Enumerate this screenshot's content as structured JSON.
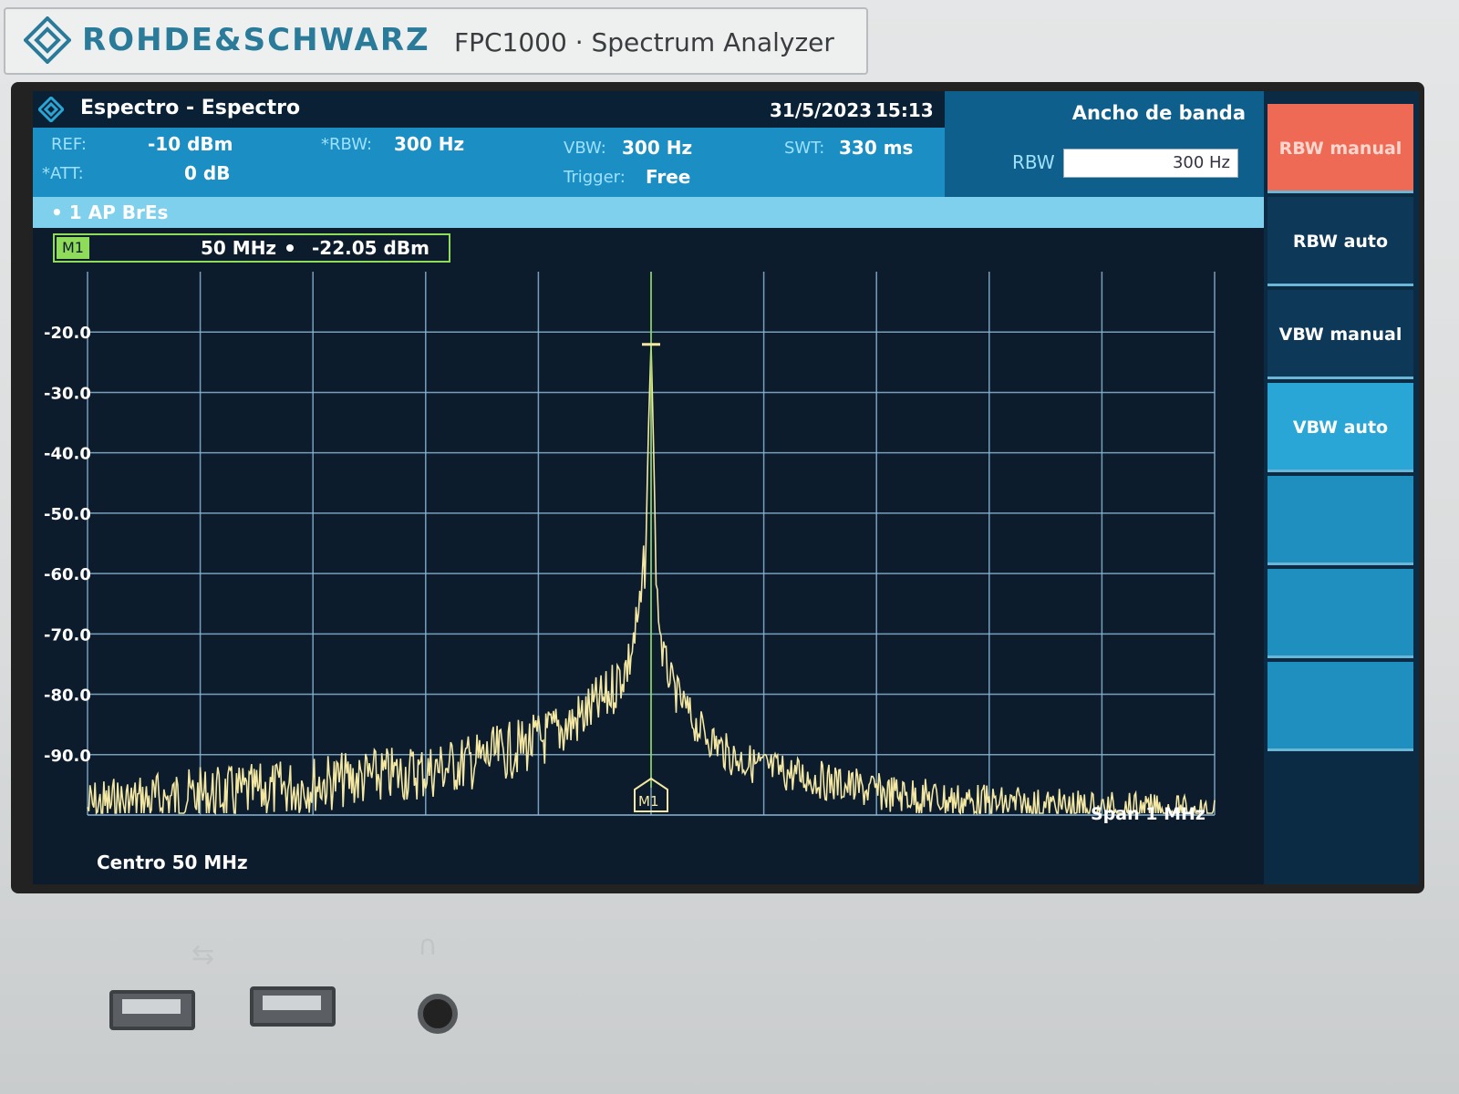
{
  "device": {
    "brand": "ROHDE&SCHWARZ",
    "model": "FPC1000 · Spectrum Analyzer"
  },
  "screen": {
    "title": "Espectro - Espectro",
    "date": "31/5/2023",
    "time": "15:13",
    "params": {
      "ref_label": "REF:",
      "ref_value": "-10 dBm",
      "att_label": "*ATT:",
      "att_value": "0 dB",
      "rbw_label": "*RBW:",
      "rbw_value": "300 Hz",
      "vbw_label": "VBW:",
      "vbw_value": "300 Hz",
      "trigger_label": "Trigger:",
      "trigger_value": "Free",
      "swt_label": "SWT:",
      "swt_value": "330 ms"
    },
    "bandwidth_panel": {
      "title": "Ancho de banda",
      "rbw_label": "RBW",
      "rbw_input_value": "300 Hz"
    },
    "trace_label": "• 1 AP BrEs",
    "marker": {
      "tag": "M1",
      "frequency": "50 MHz",
      "level": "-22.05 dBm"
    },
    "softkeys": [
      {
        "label": "RBW manual",
        "state": "active"
      },
      {
        "label": "RBW auto",
        "state": "normal"
      },
      {
        "label": "VBW manual",
        "state": "normal"
      },
      {
        "label": "VBW auto",
        "state": "highlight"
      },
      {
        "label": "",
        "state": "empty"
      },
      {
        "label": "",
        "state": "empty"
      },
      {
        "label": "",
        "state": "empty"
      }
    ],
    "center_label": "Centro 50 MHz",
    "span_label": "Span 1 MHz",
    "colors": {
      "trace": "#f3e7a2",
      "marker": "#8fdc5a",
      "grid": "#8ab7d6",
      "plot_bg": "#0d1c2d",
      "softkey_active": "#ef6a55",
      "param_bg": "#1b8fc4"
    }
  },
  "chart_data": {
    "type": "line",
    "title": "",
    "xlabel": "Centro 50 MHz",
    "ylabel": "",
    "x_axis": {
      "center_mhz": 50,
      "span_mhz": 1,
      "divisions": 10
    },
    "ylim": [
      -100,
      -10
    ],
    "y_ticks": [
      -20.0,
      -30.0,
      -40.0,
      -50.0,
      -60.0,
      -70.0,
      -80.0,
      -90.0
    ],
    "y_tick_labels": [
      "-20.0",
      "-30.0",
      "-40.0",
      "-50.0",
      "-60.0",
      "-70.0",
      "-80.0",
      "-90.0"
    ],
    "grid": true,
    "series": [
      {
        "x": [
          49.5,
          49.55,
          49.6,
          49.65,
          49.7,
          49.75,
          49.8,
          49.85,
          49.9,
          49.93,
          49.96,
          49.98,
          49.99,
          49.995,
          50.0,
          50.005,
          50.01,
          50.02,
          50.04,
          50.07,
          50.1,
          50.15,
          50.2,
          50.25,
          50.3,
          50.35,
          50.4,
          50.45,
          50.5
        ],
        "y": [
          -94,
          -93,
          -92,
          -91.5,
          -90,
          -89,
          -88,
          -86,
          -83,
          -80,
          -76,
          -70,
          -62,
          -52,
          -22.05,
          -60,
          -70,
          -76,
          -82,
          -87,
          -89,
          -91,
          -93,
          -94,
          -95,
          -95.5,
          -96,
          -96.5,
          -97
        ]
      }
    ],
    "marker": {
      "name": "M1",
      "x": 50.0,
      "y": -22.05
    }
  }
}
